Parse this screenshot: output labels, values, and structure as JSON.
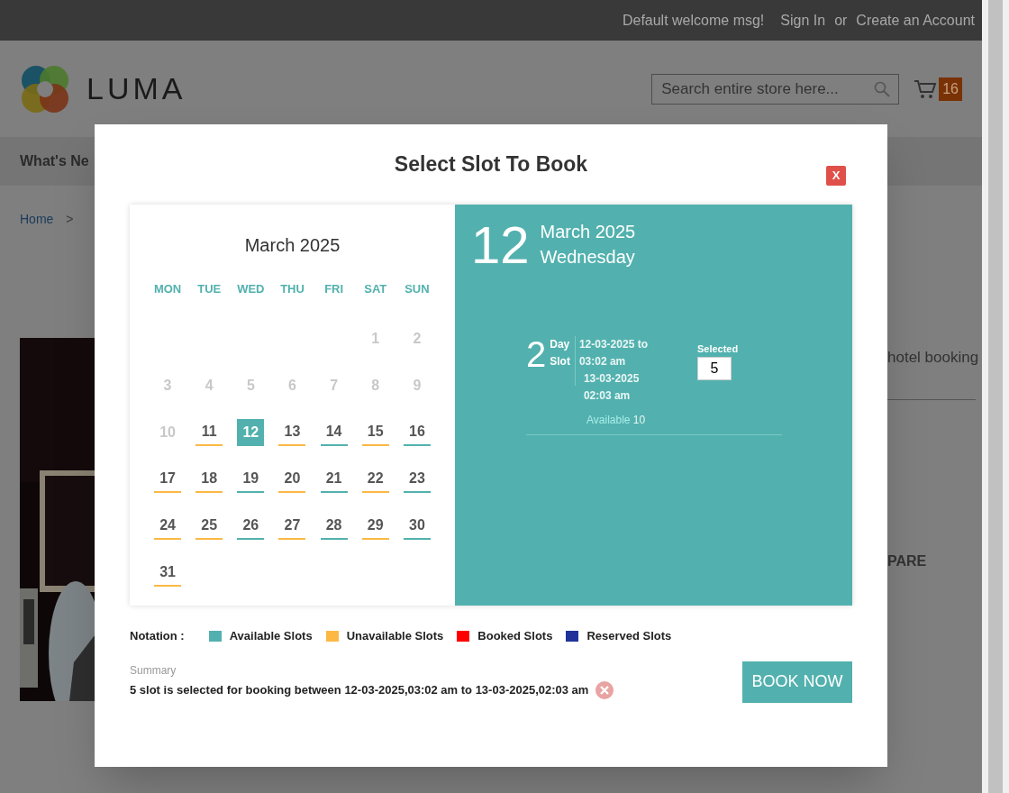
{
  "top_bar": {
    "welcome": "Default welcome msg!",
    "sign_in": "Sign In",
    "or": "or",
    "create_account": "Create an Account"
  },
  "header": {
    "logo_text": "LUMA",
    "search": {
      "placeholder": "Search entire store here..."
    },
    "cart_count": "16"
  },
  "nav": {
    "item": "What's Ne"
  },
  "breadcrumb": {
    "home": "Home",
    "separator": ">"
  },
  "background_texts": {
    "product_title_fragment": "hotel booking",
    "compare_fragment": "PARE"
  },
  "modal": {
    "title": "Select Slot To Book",
    "close": "X",
    "calendar": {
      "month": "March 2025",
      "weekdays": [
        "MON",
        "TUE",
        "WED",
        "THU",
        "FRI",
        "SAT",
        "SUN"
      ],
      "weeks": [
        [
          {
            "day": "1",
            "kind": "disabled",
            "selected": false
          },
          {
            "day": "2",
            "kind": "disabled",
            "selected": false
          }
        ],
        [
          {
            "day": "3",
            "kind": "disabled",
            "selected": false
          },
          {
            "day": "4",
            "kind": "disabled",
            "selected": false
          },
          {
            "day": "5",
            "kind": "disabled",
            "selected": false
          },
          {
            "day": "6",
            "kind": "disabled",
            "selected": false
          },
          {
            "day": "7",
            "kind": "disabled",
            "selected": false
          },
          {
            "day": "8",
            "kind": "disabled",
            "selected": false
          },
          {
            "day": "9",
            "kind": "disabled",
            "selected": false
          }
        ],
        [
          {
            "day": "10",
            "kind": "disabled",
            "selected": false
          },
          {
            "day": "11",
            "kind": "unavailable",
            "selected": false
          },
          {
            "day": "12",
            "kind": "available",
            "selected": true
          },
          {
            "day": "13",
            "kind": "unavailable",
            "selected": false
          },
          {
            "day": "14",
            "kind": "available",
            "selected": false
          },
          {
            "day": "15",
            "kind": "unavailable",
            "selected": false
          },
          {
            "day": "16",
            "kind": "available",
            "selected": false
          }
        ],
        [
          {
            "day": "17",
            "kind": "unavailable",
            "selected": false
          },
          {
            "day": "18",
            "kind": "unavailable",
            "selected": false
          },
          {
            "day": "19",
            "kind": "available",
            "selected": false
          },
          {
            "day": "20",
            "kind": "unavailable",
            "selected": false
          },
          {
            "day": "21",
            "kind": "available",
            "selected": false
          },
          {
            "day": "22",
            "kind": "unavailable",
            "selected": false
          },
          {
            "day": "23",
            "kind": "available",
            "selected": false
          }
        ],
        [
          {
            "day": "24",
            "kind": "unavailable",
            "selected": false
          },
          {
            "day": "25",
            "kind": "unavailable",
            "selected": false
          },
          {
            "day": "26",
            "kind": "available",
            "selected": false
          },
          {
            "day": "27",
            "kind": "unavailable",
            "selected": false
          },
          {
            "day": "28",
            "kind": "available",
            "selected": false
          },
          {
            "day": "29",
            "kind": "unavailable",
            "selected": false
          },
          {
            "day": "30",
            "kind": "available",
            "selected": false
          }
        ],
        [
          {
            "day": "31",
            "kind": "unavailable",
            "selected": false
          }
        ]
      ]
    },
    "selected_day": {
      "day": "12",
      "month_year": "March 2025",
      "weekday": "Wednesday"
    },
    "slots": [
      {
        "count": "2",
        "unit": "Day",
        "word": "Slot",
        "from_date": "12-03-2025 to",
        "from_time": "03:02 am",
        "to_date": "13-03-2025",
        "to_time": "02:03 am",
        "available_label": "Available",
        "available_count": "10",
        "selected_label": "Selected",
        "selected_value": "5"
      }
    ],
    "notation": {
      "label": "Notation :",
      "items": [
        {
          "label": "Available Slots",
          "color": "#52b1ae"
        },
        {
          "label": "Unavailable Slots",
          "color": "#fbb944"
        },
        {
          "label": "Booked Slots",
          "color": "#ff0000"
        },
        {
          "label": "Reserved Slots",
          "color": "#21339b"
        }
      ]
    },
    "summary": {
      "label": "Summary",
      "text": "5 slot is selected for booking between 12-03-2025,03:02 am to 13-03-2025,02:03 am"
    },
    "book_button": "BOOK NOW"
  }
}
